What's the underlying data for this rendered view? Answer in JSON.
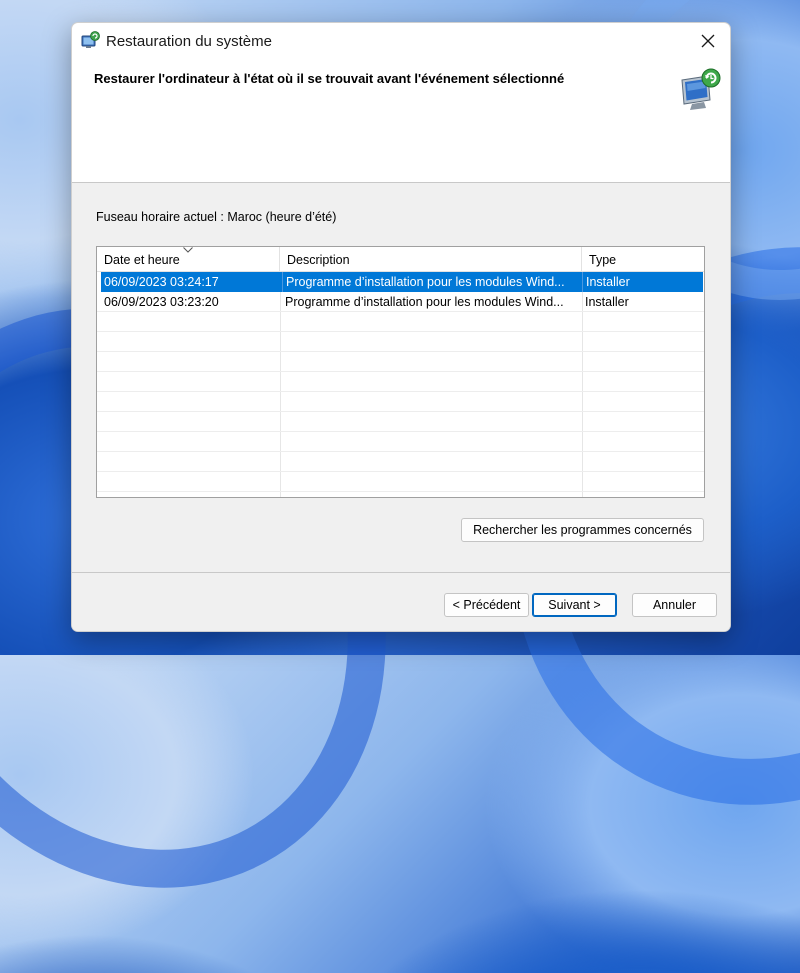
{
  "window": {
    "title": "Restauration du système",
    "icon": "system-restore-icon"
  },
  "header": {
    "heading": "Restaurer l'ordinateur à l'état où il se trouvait avant l'événement sélectionné",
    "icon": "system-restore-monitor-icon"
  },
  "timezone_label": "Fuseau horaire actuel : Maroc (heure d’été)",
  "table": {
    "columns": [
      "Date et heure",
      "Description",
      "Type"
    ],
    "sorted_column": "Date et heure",
    "rows": [
      {
        "date": "06/09/2023 03:24:17",
        "description": "Programme d’installation pour les modules Wind...",
        "type": "Installer",
        "selected": true
      },
      {
        "date": "06/09/2023 03:23:20",
        "description": "Programme d’installation pour les modules Wind...",
        "type": "Installer",
        "selected": false
      }
    ]
  },
  "buttons": {
    "scan": "Rechercher les programmes concernés",
    "back": "< Précédent",
    "next": "Suivant >",
    "cancel": "Annuler"
  },
  "colors": {
    "selection": "#0078d7",
    "default_button_border": "#0067c0"
  }
}
